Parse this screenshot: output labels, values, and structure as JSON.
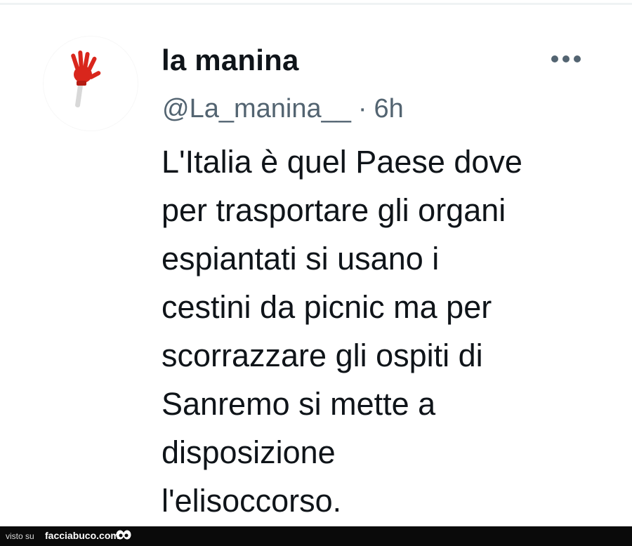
{
  "tweet": {
    "display_name": "la manina",
    "handle": "@La_manina__",
    "separator": "·",
    "time": "6h",
    "text_lines": [
      "L'Italia è quel Paese dove",
      "per trasportare gli organi",
      "espiantati si usano i",
      "cestini da picnic ma per",
      "scorrazzare gli ospiti di",
      "Sanremo si mette a",
      "disposizione",
      "l'elisoccorso."
    ],
    "avatar_icon": "red-hand-clapper-icon",
    "more_icon": "more-options-icon"
  },
  "footer": {
    "visto_label": "visto su",
    "brand": "facciabuco.com",
    "logo_icon": "eyes-icon"
  },
  "colors": {
    "text_primary": "#0f1419",
    "text_secondary": "#536471",
    "footer_bg": "#0a0a0a",
    "avatar_hand": "#d9261c"
  }
}
